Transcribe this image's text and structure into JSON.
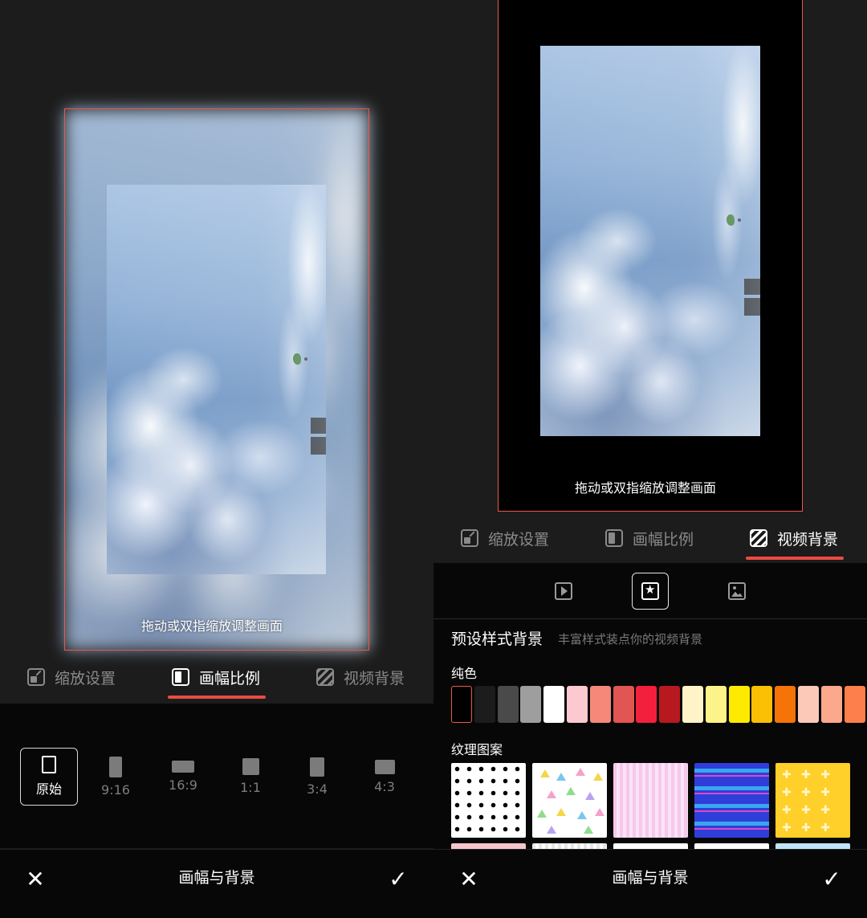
{
  "left": {
    "hint": "拖动或双指缩放调整画面",
    "tabs": [
      {
        "label": "缩放设置"
      },
      {
        "label": "画幅比例"
      },
      {
        "label": "视频背景"
      }
    ],
    "active_tab": "画幅比例",
    "ratios": [
      {
        "label": "原始"
      },
      {
        "label": "9:16"
      },
      {
        "label": "16:9"
      },
      {
        "label": "1:1"
      },
      {
        "label": "3:4"
      },
      {
        "label": "4:3"
      }
    ],
    "selected_ratio": "原始",
    "bottom": {
      "close_icon": "close-icon",
      "title": "画幅与背景",
      "confirm_icon": "check-icon"
    }
  },
  "right": {
    "hint": "拖动或双指缩放调整画面",
    "tabs": [
      {
        "label": "缩放设置"
      },
      {
        "label": "画幅比例"
      },
      {
        "label": "视频背景"
      }
    ],
    "active_tab": "视频背景",
    "source_buttons": [
      "video-frame-icon",
      "preset-style-icon",
      "image-icon"
    ],
    "preset_title": "预设样式背景",
    "preset_subtitle": "丰富样式装点你的视频背景",
    "solid_label": "纯色",
    "solid_colors": [
      "#000000",
      "#1c1c1c",
      "#4a4a4a",
      "#9e9e9e",
      "#ffffff",
      "#fbc9cf",
      "#f6887a",
      "#e15552",
      "#f41f3c",
      "#b8191e",
      "#fff3c8",
      "#fdf489",
      "#feea00",
      "#fbbf03",
      "#f67308",
      "#fcc9b8",
      "#fca88d",
      "#fc7f4c"
    ],
    "texture_label": "纹理图案",
    "textures": [
      "dots",
      "triangles",
      "pink-stripes",
      "blue-waves",
      "yellow-crosses"
    ],
    "bottom": {
      "close_icon": "close-icon",
      "title": "画幅与背景",
      "confirm_icon": "check-icon"
    }
  },
  "colors": {
    "accent": "#ea4c43",
    "panel": "#070707",
    "background": "#1c1c1c"
  }
}
